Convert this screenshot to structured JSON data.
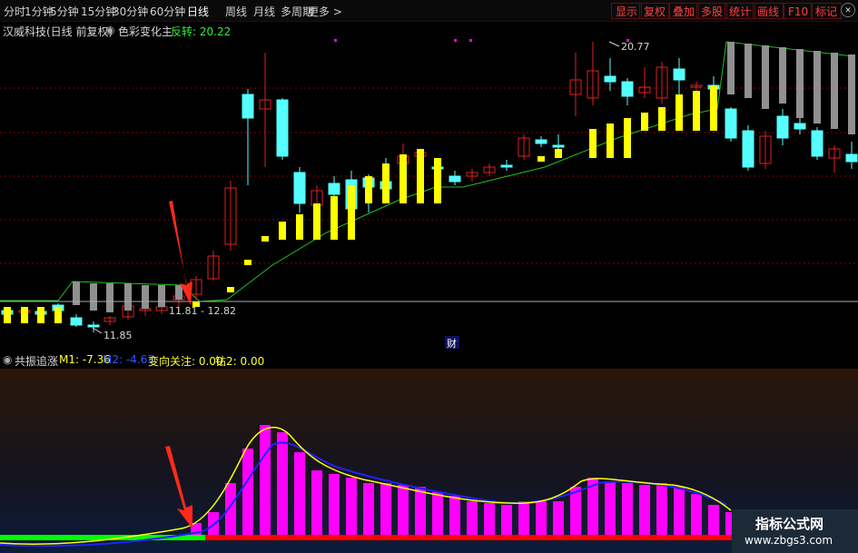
{
  "toolbar": {
    "timeframes": [
      "分时",
      "1分钟",
      "5分钟",
      "15分钟",
      "30分钟",
      "60分钟",
      "日线",
      "周线",
      "月线",
      "多周期",
      "更多 >"
    ],
    "active": "日线",
    "right_buttons": [
      "显示",
      "复权",
      "叠加",
      "多股",
      "统计",
      "画线",
      "F10",
      "标记",
      "-/+"
    ]
  },
  "main_panel": {
    "stock_title": "汉威科技(日线 前复权)",
    "indicator_name": "色彩变化主",
    "reversal_label": "反转: 20.22",
    "high_label": "20.77",
    "low_label": "11.85",
    "range_label": "11.81 - 12.82",
    "finance_badge": "财",
    "colors": {
      "up": "#e02020",
      "down": "#55ffff",
      "bull_bar": "#ffff00",
      "bear_bar": "#909090",
      "line": "#20c020"
    }
  },
  "sub_panel": {
    "name": "共振追涨",
    "m1_label": "M1: -7.36",
    "m2_label": "M2: -4.63",
    "focus_label": "变向关注: 0.00",
    "drill_label": "钻2: 0.00",
    "colors": {
      "bar": "#ff00ff",
      "m1": "#ffff00",
      "m2": "#2020ff",
      "base_green": "#00ff00",
      "base_red": "#ff0000"
    }
  },
  "watermark": {
    "title": "指标公式网",
    "url": "www.zbgs3.com"
  }
}
